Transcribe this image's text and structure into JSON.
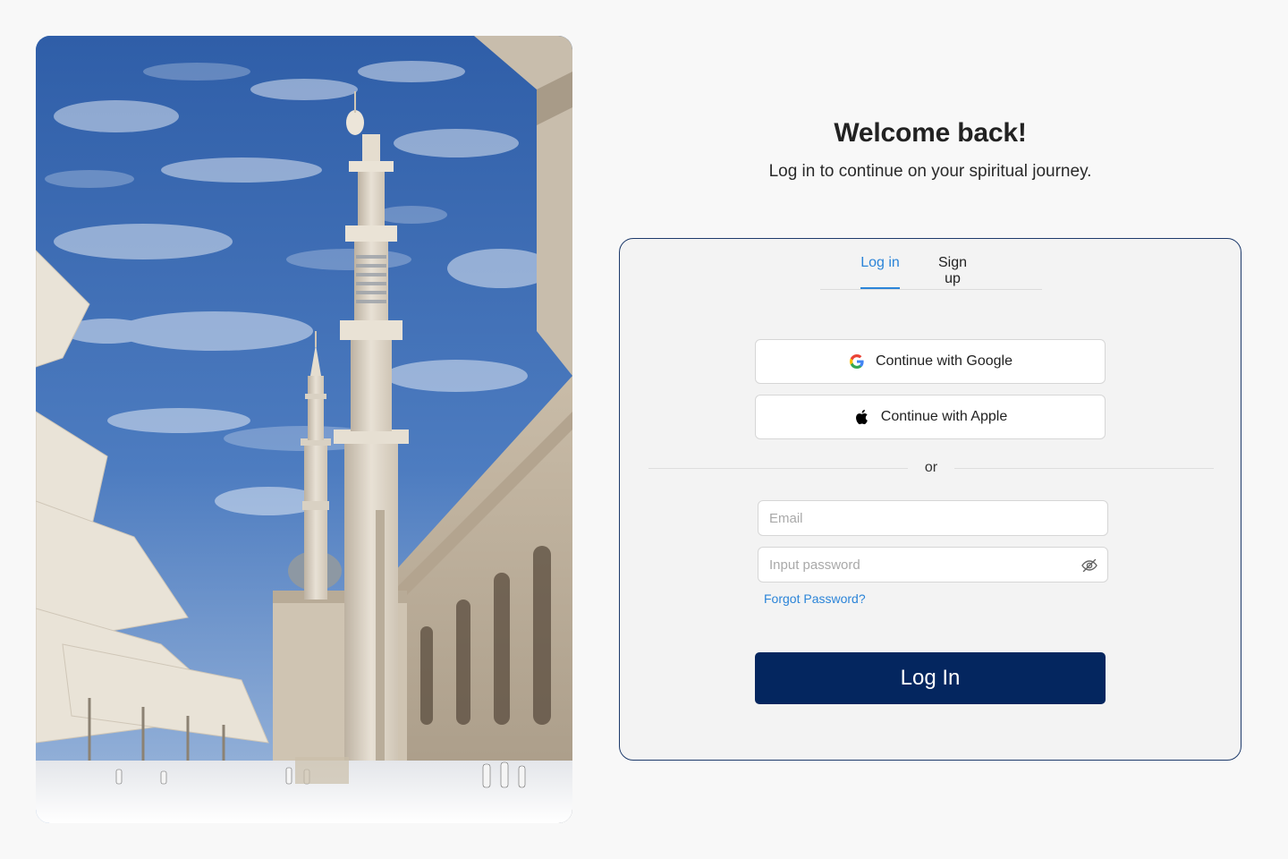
{
  "header": {
    "title": "Welcome back!",
    "subtitle": "Log in to continue on your spiritual journey."
  },
  "tabs": [
    {
      "label": "Log in",
      "active": true
    },
    {
      "label": "Sign up",
      "active": false
    }
  ],
  "oauth": {
    "google_label": "Continue with Google",
    "apple_label": "Continue with Apple"
  },
  "divider_label": "or",
  "form": {
    "email_placeholder": "Email",
    "email_value": "",
    "password_placeholder": "Input password",
    "password_value": "",
    "forgot_label": "Forgot Password?",
    "submit_label": "Log In"
  },
  "icons": {
    "google": "google-icon",
    "apple": "apple-icon",
    "password_toggle": "eye-off-icon"
  },
  "colors": {
    "accent": "#2b84d8",
    "primary_button": "#04265f",
    "card_border": "#1d3a6b",
    "card_background": "#f3f3f3",
    "page_background": "#f8f8f8"
  }
}
